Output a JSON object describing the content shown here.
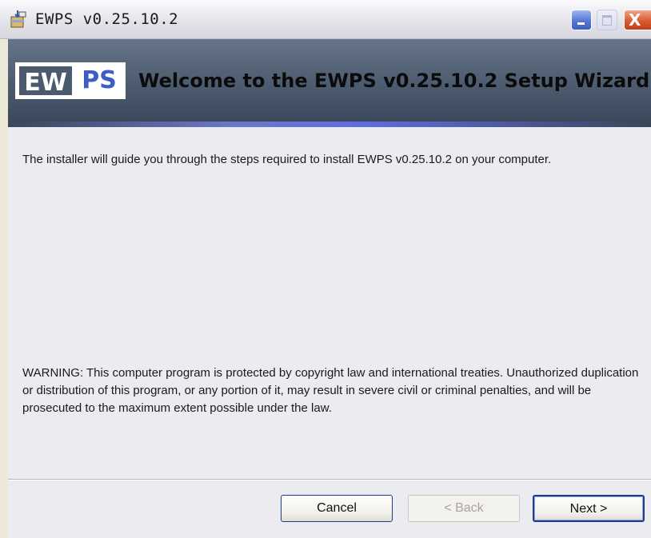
{
  "window": {
    "title": "EWPS v0.25.10.2",
    "icon": "installer-package-icon"
  },
  "caption_buttons": {
    "minimize": "minimize-icon",
    "maximize": "maximize-icon",
    "close": "X"
  },
  "banner": {
    "logo_left": "EW",
    "logo_right": "PS",
    "title": "Welcome to the EWPS v0.25.10.2 Setup Wizard"
  },
  "content": {
    "intro": "The installer will guide you through the steps required to install EWPS v0.25.10.2 on your computer.",
    "warning": "WARNING: This computer program is protected by copyright law and international treaties. Unauthorized duplication or distribution of this program, or any portion of it, may result in severe civil or criminal penalties, and will be prosecuted to the maximum extent possible under the law."
  },
  "buttons": {
    "cancel": "Cancel",
    "back": "< Back",
    "next": "Next >"
  },
  "colors": {
    "banner": "#4c5a6e",
    "accent": "#3d5ec4",
    "close": "#d95a33"
  }
}
